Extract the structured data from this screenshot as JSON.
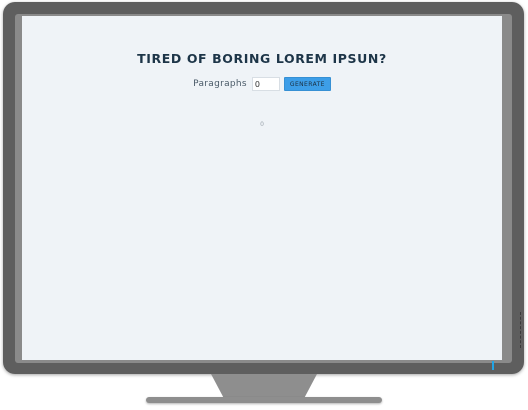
{
  "app": {
    "title": "TIRED OF BORING LOREM IPSUN?"
  },
  "form": {
    "paragraphs_label": "Paragraphs",
    "paragraphs_value": "0",
    "generate_label": "GENERATE"
  },
  "output": {
    "text": "0"
  },
  "colors": {
    "accent": "#3d9ee8",
    "title": "#1d3548",
    "screen_background": "#eff3f7",
    "monitor_frame": "#5e5e5e",
    "power_led": "#22a5e6"
  },
  "icons": {
    "power_indicator": "power-led-icon"
  }
}
